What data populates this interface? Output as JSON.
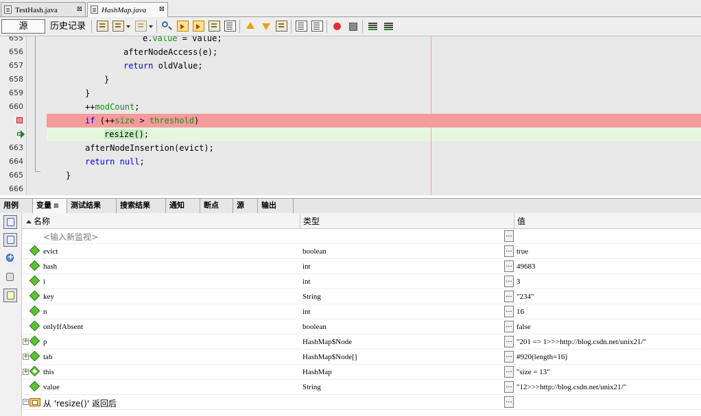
{
  "editor_tabs": [
    {
      "label": "TestHash.java",
      "close": "⊠"
    },
    {
      "label": "HashMap.java",
      "close": "⊠"
    }
  ],
  "toolbar": {
    "source_label": "源",
    "history_label": "历史记录"
  },
  "code": {
    "lines": [
      {
        "num": "655",
        "tokens": [
          {
            "t": "e.",
            "c": ""
          },
          {
            "t": "value",
            "c": "fld"
          },
          {
            "t": " = value;",
            "c": ""
          }
        ]
      },
      {
        "num": "656",
        "tokens": [
          {
            "t": "afterNodeAccess(e);",
            "c": ""
          }
        ]
      },
      {
        "num": "657",
        "tokens": [
          {
            "t": "return",
            "c": "kw"
          },
          {
            "t": " oldValue;",
            "c": ""
          }
        ]
      },
      {
        "num": "658",
        "tokens": [
          {
            "t": "}",
            "c": ""
          }
        ]
      },
      {
        "num": "659",
        "tokens": [
          {
            "t": "}",
            "c": ""
          }
        ]
      },
      {
        "num": "660",
        "tokens": [
          {
            "t": "++",
            "c": ""
          },
          {
            "t": "modCount",
            "c": "fld"
          },
          {
            "t": ";",
            "c": ""
          }
        ]
      },
      {
        "num": "",
        "tokens": [
          {
            "t": "if",
            "c": "kw"
          },
          {
            "t": " (++",
            "c": ""
          },
          {
            "t": "size",
            "c": "fld"
          },
          {
            "t": " > ",
            "c": ""
          },
          {
            "t": "threshold",
            "c": "fld"
          },
          {
            "t": ")",
            "c": ""
          }
        ]
      },
      {
        "num": "",
        "tokens": [
          {
            "t": "resize()",
            "c": "hl"
          },
          {
            "t": ";",
            "c": ""
          }
        ]
      },
      {
        "num": "663",
        "tokens": [
          {
            "t": "afterNodeInsertion(evict);",
            "c": ""
          }
        ]
      },
      {
        "num": "664",
        "tokens": [
          {
            "t": "return",
            "c": "kw"
          },
          {
            "t": " ",
            "c": ""
          },
          {
            "t": "null",
            "c": "kw"
          },
          {
            "t": ";",
            "c": ""
          }
        ]
      },
      {
        "num": "665",
        "tokens": [
          {
            "t": "}",
            "c": ""
          }
        ]
      },
      {
        "num": "666",
        "tokens": []
      }
    ]
  },
  "bottom_tabs": [
    "用例",
    "变量",
    "测试结果",
    "搜索结果",
    "通知",
    "断点",
    "源",
    "输出"
  ],
  "bottom_tab_close": "⊠",
  "variables": {
    "headers": {
      "name": "名称",
      "type": "类型",
      "value": "值"
    },
    "new_watch_placeholder": "<输入新监视>",
    "ellipsis": "...",
    "rows": [
      {
        "name": "evict",
        "type": "boolean",
        "value": "true"
      },
      {
        "name": "hash",
        "type": "int",
        "value": "49683"
      },
      {
        "name": "i",
        "type": "int",
        "value": "3"
      },
      {
        "name": "key",
        "type": "String",
        "value": "\"234\""
      },
      {
        "name": "n",
        "type": "int",
        "value": "16"
      },
      {
        "name": "onlyIfAbsent",
        "type": "boolean",
        "value": "false"
      },
      {
        "name": "p",
        "type": "HashMap$Node",
        "value": "\"201 => 1>>>http://blog.csdn.net/unix21/\""
      },
      {
        "name": "tab",
        "type": "HashMap$Node[]",
        "value": "#920(length=16)"
      },
      {
        "name": "this",
        "type": "HashMap",
        "value": "\"size = 13\""
      },
      {
        "name": "value",
        "type": "String",
        "value": "\"12>>>http://blog.csdn.net/unix21/\""
      }
    ],
    "return_row_label": "从 'resize()' 返回后"
  }
}
